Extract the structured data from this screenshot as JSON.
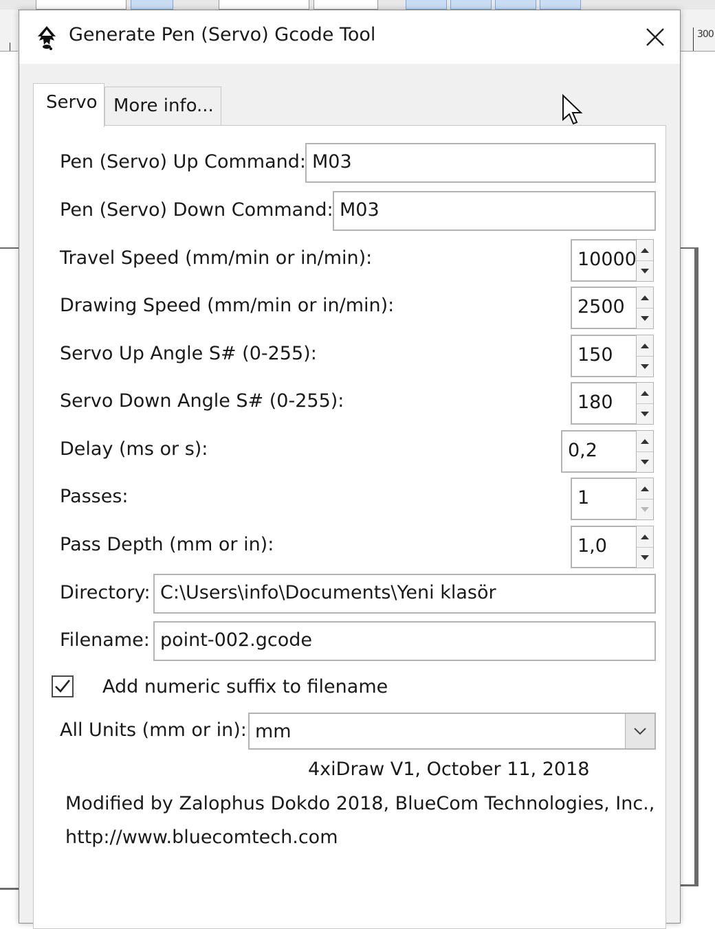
{
  "dialog": {
    "title": "Generate Pen (Servo) Gcode Tool"
  },
  "tabs": [
    {
      "label": "Servo"
    },
    {
      "label": "More info..."
    }
  ],
  "fields": {
    "pen_up": {
      "label": "Pen (Servo) Up Command:",
      "value": "M03"
    },
    "pen_down": {
      "label": "Pen (Servo) Down Command:",
      "value": "M03"
    },
    "travel_speed": {
      "label": "Travel Speed (mm/min or in/min):",
      "value": "10000"
    },
    "drawing_speed": {
      "label": "Drawing Speed (mm/min or in/min):",
      "value": "2500"
    },
    "servo_up_angle": {
      "label": "Servo Up Angle S# (0-255):",
      "value": "150"
    },
    "servo_down_angle": {
      "label": "Servo Down Angle S# (0-255):",
      "value": "180"
    },
    "delay": {
      "label": "Delay (ms or s):",
      "value": "0,2"
    },
    "passes": {
      "label": "Passes:",
      "value": "1"
    },
    "pass_depth": {
      "label": "Pass Depth (mm or in):",
      "value": "1,0"
    },
    "directory": {
      "label": "Directory:",
      "value": "C:\\Users\\info\\Documents\\Yeni klasör"
    },
    "filename": {
      "label": "Filename:",
      "value": "point-002.gcode"
    },
    "numeric_suffix": {
      "label": "Add numeric suffix to filename",
      "checked": true
    },
    "units": {
      "label": "All Units (mm or in):",
      "value": "mm"
    }
  },
  "footer": {
    "version": "4xiDraw V1, October 11, 2018",
    "credit_line1": "Modified by Zalophus Dokdo 2018, BlueCom Technologies, Inc.,",
    "credit_line2": "http://www.bluecomtech.com"
  },
  "background": {
    "ruler_mark": "300"
  }
}
